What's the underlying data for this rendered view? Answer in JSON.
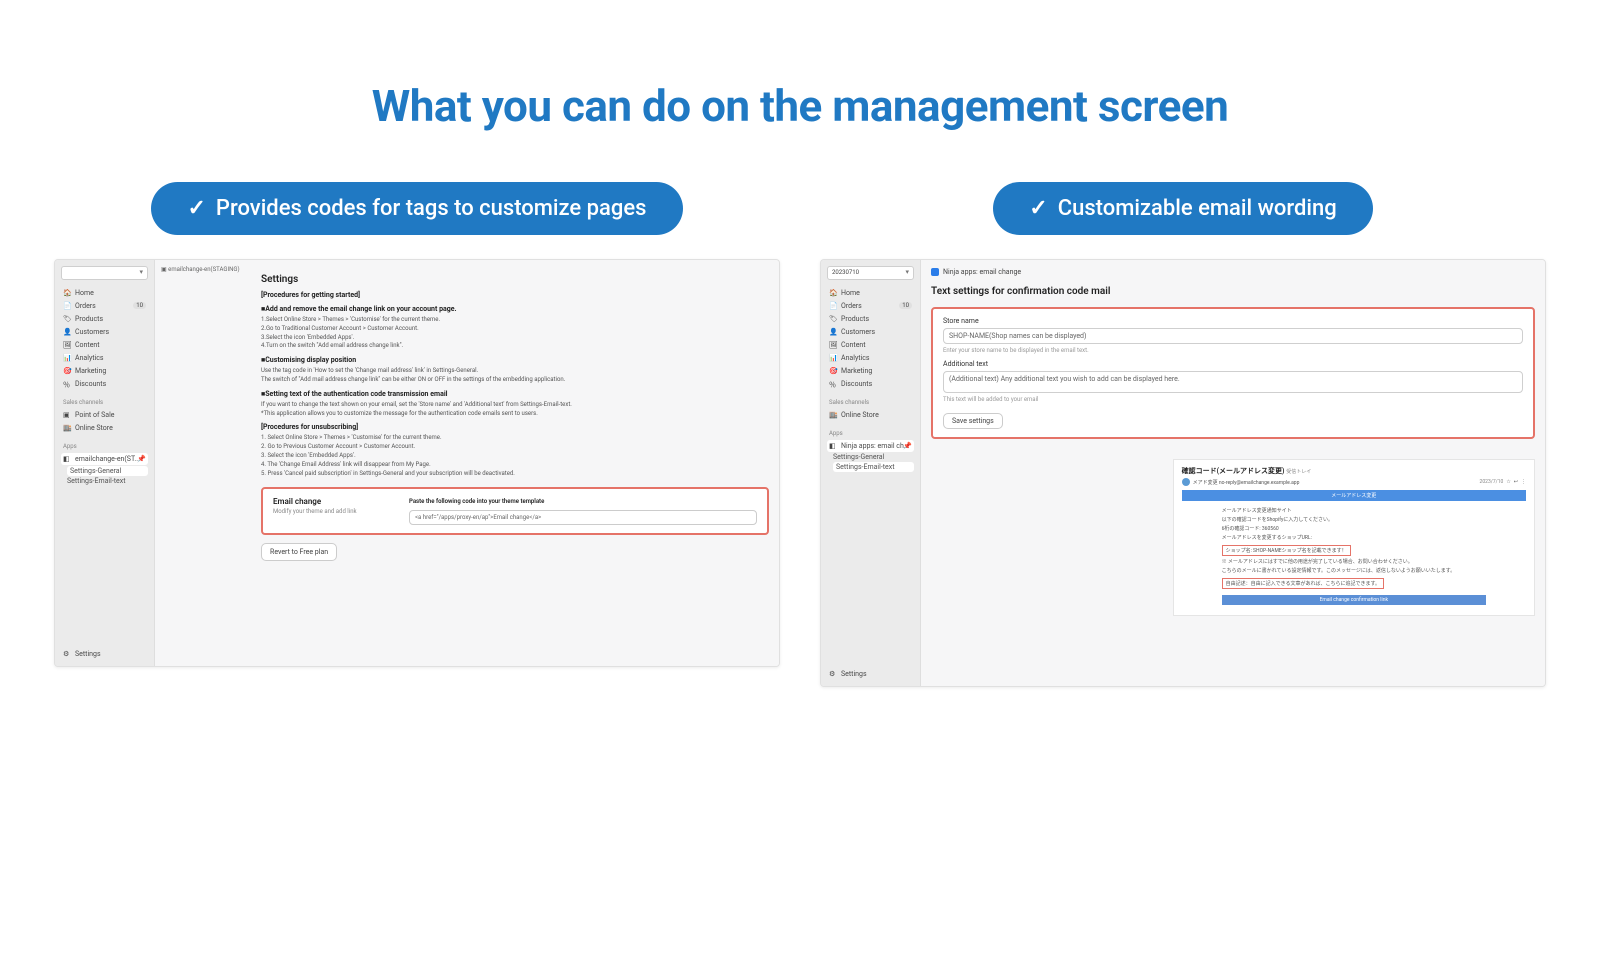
{
  "title": "What you can do on the management screen",
  "pills": {
    "left": "Provides codes for tags to customize pages",
    "right": "Customizable email wording"
  },
  "sidebar": {
    "items": [
      {
        "icon": "home-icon",
        "label": "Home"
      },
      {
        "icon": "orders-icon",
        "label": "Orders",
        "badge": "10"
      },
      {
        "icon": "products-icon",
        "label": "Products"
      },
      {
        "icon": "customers-icon",
        "label": "Customers"
      },
      {
        "icon": "content-icon",
        "label": "Content"
      },
      {
        "icon": "analytics-icon",
        "label": "Analytics"
      },
      {
        "icon": "marketing-icon",
        "label": "Marketing"
      },
      {
        "icon": "discounts-icon",
        "label": "Discounts"
      }
    ],
    "sales_channels_hdr": "Sales channels",
    "pos": "Point of Sale",
    "online_store": "Online Store",
    "apps_hdr": "Apps",
    "app_name": "emailchange-en(ST...",
    "app_sub": [
      "Settings-General",
      "Settings-Email-text"
    ],
    "settings": "Settings"
  },
  "left_shot": {
    "breadcrumb": "emailchange-en(STAGING)",
    "h_settings": "Settings",
    "proc_start": "[Procedures for getting started]",
    "sec1_title": "■Add and remove the email change link on your account page.",
    "sec1_lines": [
      "1.Select Online Store > Themes > 'Customise' for the current theme.",
      "2.Go to Traditional Customer Account > Customer Account.",
      "3.Select the icon 'Embedded Apps'.",
      "4.Turn on the switch \"Add email address change link\"."
    ],
    "sec2_title": "■Customising display position",
    "sec2_lines": [
      "Use the tag code in 'How to set the 'Change mail address' link' in Settings-General.",
      "The switch of \"Add mail address change link\" can be either ON or OFF in the settings of the embedding application."
    ],
    "sec3_title": "■Setting text of the authentication code transmission email",
    "sec3_lines": [
      "If you want to change the text shown on your email, set the 'Store name' and 'Additional text' from Settings-Email-text.",
      "*This application allows you to customize the message for the authentication code emails sent to users."
    ],
    "proc_unsub": "[Procedures for unsubscribing]",
    "unsub_lines": [
      "1. Select Online Store > Themes > 'Customise' for the current theme.",
      "2. Go to Previous Customer Account > Customer Account.",
      "3. Select the icon 'Embedded Apps'.",
      "4. The 'Change Email Address' link will disappear from My Page.",
      "5. Press 'Cancel paid subscription' in Settings-General and your subscription will be deactivated."
    ],
    "email_change_title": "Email change",
    "email_change_sub": "Modify your theme and add link",
    "paste_label": "Paste the following code into your theme template",
    "code_value": "<a href=\"/apps/proxy-en/ap\">Email change</a>",
    "revert": "Revert to Free plan"
  },
  "right_sidebar": {
    "shop_select": "20230710",
    "app_name": "Ninja apps: email ch...",
    "app_sub": [
      "Settings-General",
      "Settings-Email-text"
    ]
  },
  "right_shot": {
    "appbar": "Ninja apps: email change",
    "card_title": "Text settings for confirmation code mail",
    "store_name_label": "Store name",
    "store_name_value": "SHOP-NAME(Shop names can be displayed)",
    "store_name_hint": "Enter your store name to be displayed in the email text.",
    "additional_label": "Additional text",
    "additional_value": "(Additional text) Any additional text you wish to add can be displayed here.",
    "additional_hint": "This text will be added to your email",
    "save": "Save settings",
    "mail": {
      "subject": "確認コード(メールアドレス変更)",
      "inbox_tag": "受信トレイ",
      "from": "メアド変更 no-reply@emailchange.example.app",
      "date": "2023/7/10",
      "banner": "メールアドレス変更",
      "l1": "メールアドレス変更通知サイト",
      "l2": "以下の確認コードをShopifyに入力してください。",
      "l3": "6桁の確認コード: 360560",
      "l4": "メールアドレスを変更するショップURL:",
      "red1": "ショップ名: SHOP-NAMEショップ名を記載できます！",
      "b1": "※ メールアドレスにはすでに他の用途が完了している場合、お問い合わせください。",
      "b2": "こちらのメールに書かれている設定情報です。このメッセージには、返信しないようお願いいたします。",
      "red2": "自由記述：自由に記入できる文章があれば、こちらに追記できます。",
      "footer_btn": "Email change confirmation link"
    }
  }
}
